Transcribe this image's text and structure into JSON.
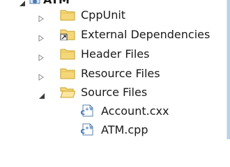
{
  "tree": {
    "root": {
      "label": "ATM",
      "icon": "cpp-project-icon",
      "expanded": true
    },
    "items": [
      {
        "label": "CppUnit",
        "icon": "folder-icon",
        "expanded": false
      },
      {
        "label": "External Dependencies",
        "icon": "external-dependencies-icon",
        "expanded": false
      },
      {
        "label": "Header Files",
        "icon": "folder-icon",
        "expanded": false
      },
      {
        "label": "Resource Files",
        "icon": "folder-icon",
        "expanded": false
      },
      {
        "label": "Source Files",
        "icon": "open-folder-icon",
        "expanded": true,
        "children": [
          {
            "label": "Account.cxx",
            "icon": "cpp-file-icon"
          },
          {
            "label": "ATM.cpp",
            "icon": "cpp-file-icon"
          }
        ]
      }
    ]
  },
  "colors": {
    "folder_fill": "#f5d77a",
    "folder_stroke": "#c9a227",
    "arrow_collapsed": "#8a8a8a",
    "arrow_expanded": "#3c3c3c",
    "file_blue": "#2f6fb6",
    "scroll_edge": "#b9d1ea"
  }
}
